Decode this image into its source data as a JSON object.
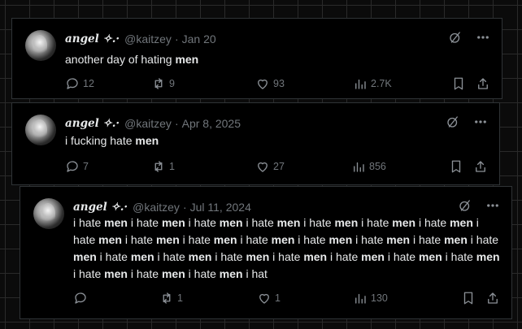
{
  "tweets": [
    {
      "author_name": "angel ✧.·",
      "handle": "@kaitzey",
      "separator": "·",
      "date": "Jan 20",
      "text_segments": [
        {
          "t": "another day of hating ",
          "bold": false
        },
        {
          "t": "men",
          "bold": true
        }
      ],
      "stats": {
        "replies": "12",
        "reposts": "9",
        "likes": "93",
        "views": "2.7K"
      }
    },
    {
      "author_name": "angel ✧.·",
      "handle": "@kaitzey",
      "separator": "·",
      "date": "Apr 8, 2025",
      "text_segments": [
        {
          "t": "i fucking hate ",
          "bold": false
        },
        {
          "t": "men",
          "bold": true
        }
      ],
      "stats": {
        "replies": "7",
        "reposts": "1",
        "likes": "27",
        "views": "856"
      }
    },
    {
      "author_name": "angel ✧.·",
      "handle": "@kaitzey",
      "separator": "·",
      "date": "Jul 11, 2024",
      "text_segments": [
        {
          "t": "i hate ",
          "bold": false
        },
        {
          "t": "men",
          "bold": true
        },
        {
          "t": " i hate ",
          "bold": false
        },
        {
          "t": "men",
          "bold": true
        },
        {
          "t": " i hate ",
          "bold": false
        },
        {
          "t": "men",
          "bold": true
        },
        {
          "t": " i hate ",
          "bold": false
        },
        {
          "t": "men",
          "bold": true
        },
        {
          "t": " i hate ",
          "bold": false
        },
        {
          "t": "men",
          "bold": true
        },
        {
          "t": " i hate ",
          "bold": false
        },
        {
          "t": "men",
          "bold": true
        },
        {
          "t": " i hate ",
          "bold": false
        },
        {
          "t": "men",
          "bold": true
        },
        {
          "t": " i hate ",
          "bold": false
        },
        {
          "t": "men",
          "bold": true
        },
        {
          "t": " i hate ",
          "bold": false
        },
        {
          "t": "men",
          "bold": true
        },
        {
          "t": " i hate ",
          "bold": false
        },
        {
          "t": "men",
          "bold": true
        },
        {
          "t": " i hate ",
          "bold": false
        },
        {
          "t": "men",
          "bold": true
        },
        {
          "t": " i hate ",
          "bold": false
        },
        {
          "t": "men",
          "bold": true
        },
        {
          "t": " i hate ",
          "bold": false
        },
        {
          "t": "men",
          "bold": true
        },
        {
          "t": " i hate ",
          "bold": false
        },
        {
          "t": "men",
          "bold": true
        },
        {
          "t": " i hate ",
          "bold": false
        },
        {
          "t": "men",
          "bold": true
        },
        {
          "t": " i hate ",
          "bold": false
        },
        {
          "t": "men",
          "bold": true
        },
        {
          "t": " i hate ",
          "bold": false
        },
        {
          "t": "men",
          "bold": true
        },
        {
          "t": " i hate ",
          "bold": false
        },
        {
          "t": "men",
          "bold": true
        },
        {
          "t": " i hate ",
          "bold": false
        },
        {
          "t": "men",
          "bold": true
        },
        {
          "t": " i hate ",
          "bold": false
        },
        {
          "t": "men",
          "bold": true
        },
        {
          "t": " i hate ",
          "bold": false
        },
        {
          "t": "men",
          "bold": true
        },
        {
          "t": " i hate ",
          "bold": false
        },
        {
          "t": "men",
          "bold": true
        },
        {
          "t": " i hate ",
          "bold": false
        },
        {
          "t": "men",
          "bold": true
        },
        {
          "t": " i hate ",
          "bold": false
        },
        {
          "t": "men",
          "bold": true
        },
        {
          "t": " i hate ",
          "bold": false
        },
        {
          "t": "men",
          "bold": true
        },
        {
          "t": " i hat",
          "bold": false
        }
      ],
      "stats": {
        "replies": "",
        "reposts": "1",
        "likes": "1",
        "views": "130"
      }
    }
  ],
  "icons": {
    "grok": "grok-icon",
    "more": "more-icon",
    "reply": "reply-icon",
    "repost": "repost-icon",
    "like": "like-icon",
    "views": "views-icon",
    "bookmark": "bookmark-icon",
    "share": "share-icon"
  },
  "colors": {
    "background": "#000000",
    "text": "#e7e9ea",
    "muted": "#71767b",
    "border": "#2f3336"
  }
}
